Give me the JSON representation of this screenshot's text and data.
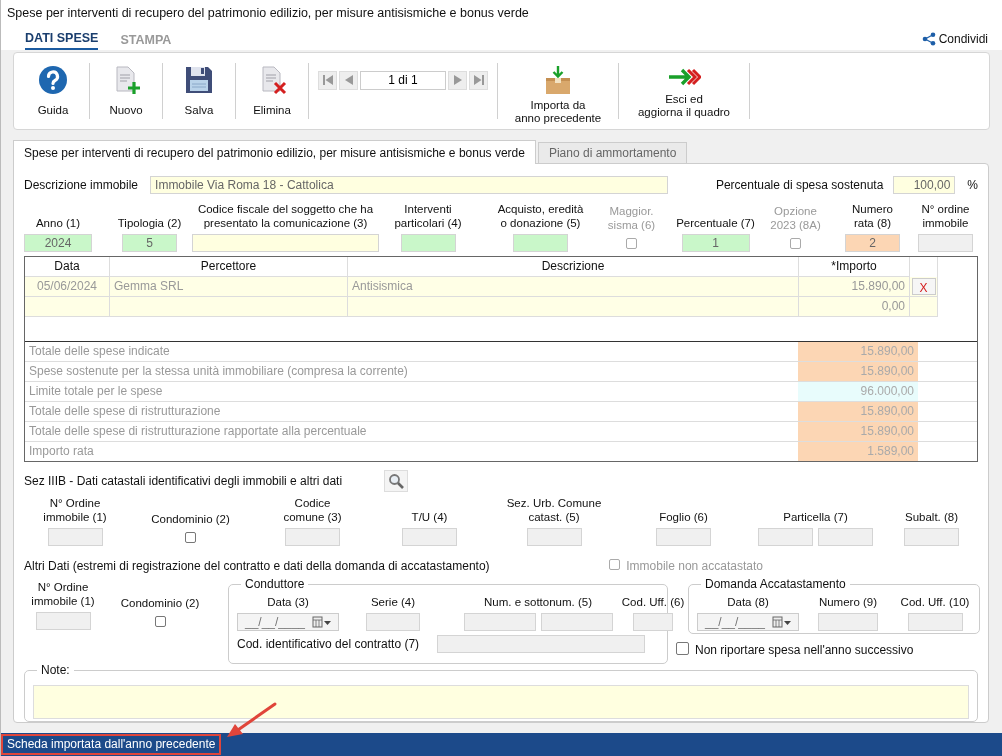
{
  "window": {
    "title": "Spese per interventi di recupero del patrimonio edilizio, per misure antisismiche e bonus verde"
  },
  "ribbon_tabs": [
    {
      "label": "DATI SPESE",
      "selected": true
    },
    {
      "label": "STAMPA",
      "selected": false
    }
  ],
  "share": {
    "label": "Condividi"
  },
  "toolbar": {
    "buttons": [
      {
        "kind": "help",
        "label": "Guida"
      },
      {
        "kind": "new",
        "label": "Nuovo"
      },
      {
        "kind": "save",
        "label": "Salva"
      },
      {
        "kind": "delete",
        "label": "Elimina"
      }
    ],
    "pager": {
      "value": "1 di 1"
    },
    "actions": [
      {
        "kind": "import",
        "label": "Importa da\nanno precedente"
      },
      {
        "kind": "exit",
        "label": "Esci ed\naggiorna il quadro"
      }
    ]
  },
  "form_tabs": [
    {
      "label": "Spese per interventi di recupero del patrimonio edilizio, per misure antisismiche e bonus verde",
      "selected": true
    },
    {
      "label": "Piano di ammortamento",
      "selected": false
    }
  ],
  "descrizione": {
    "label": "Descrizione immobile",
    "value": "Immobile Via Roma 18 - Cattolica"
  },
  "percentuale_spesa": {
    "label": "Percentuale di spesa sostenuta",
    "value": "100,00",
    "unit": "%"
  },
  "fields": [
    {
      "kind": "input",
      "label": "Anno (1)",
      "value": "2024",
      "color": "#c9f7c9",
      "disabled": false
    },
    {
      "kind": "input",
      "label": "Tipologia (2)",
      "value": "5",
      "color": "#c9f7c9",
      "disabled": false
    },
    {
      "kind": "input",
      "label": "Codice fiscale del soggetto che ha\npresentato la comunicazione (3)",
      "color": "#ffffe0",
      "disabled": false
    },
    {
      "kind": "input",
      "label": "Interventi\nparticolari (4)",
      "color": "#c9f7c9",
      "disabled": false
    },
    {
      "kind": "input",
      "label": "Acquisto, eredità\no donazione (5)",
      "color": "#c9f7c9",
      "disabled": false
    },
    {
      "kind": "checkbox",
      "label": "Maggior.\nsisma (6)",
      "checked": false,
      "disabled": true
    },
    {
      "kind": "input",
      "label": "Percentuale (7)",
      "value": "1",
      "color": "#c9f7c9",
      "disabled": false
    },
    {
      "kind": "checkbox",
      "label": "Opzione\n2023 (8A)",
      "checked": false,
      "disabled": true
    },
    {
      "kind": "input",
      "label": "Numero\nrata (8)",
      "value": "2",
      "color": "#fcd6b4",
      "disabled": false
    },
    {
      "kind": "input",
      "label": "N° ordine\nimmobile",
      "color": "#f0f0f0",
      "disabled": false
    }
  ],
  "expenses": {
    "columns": [
      "Data",
      "Percettore",
      "Descrizione",
      "*Importo"
    ],
    "rows": [
      {
        "data": "05/06/2024",
        "percettore": "Gemma SRL",
        "descrizione": "Antisismica",
        "importo": "15.890,00",
        "delete": "X"
      },
      {
        "importo": "0,00"
      }
    ],
    "totals": [
      {
        "label": "Totale delle spese indicate",
        "value": "15.890,00",
        "color": "#fcd6b4"
      },
      {
        "label": "Spese sostenute per la stessa unità immobiliare (compresa la corrente)",
        "value": "15.890,00",
        "color": "#fcd6b4"
      },
      {
        "label": "Limite totale per le spese",
        "value": "96.000,00",
        "color": "#e8fcfc"
      },
      {
        "label": "Totale delle spese di ristrutturazione",
        "value": "15.890,00",
        "color": "#fcd6b4"
      },
      {
        "label": "Totale delle spese di ristrutturazione rapportate alla percentuale",
        "value": "15.890,00",
        "color": "#fcd6b4"
      },
      {
        "label": "Importo rata",
        "value": "1.589,00",
        "color": "#fcd6b4"
      }
    ]
  },
  "catasto": {
    "title": "Sez IIIB - Dati catastali identificativi degli immobili e altri dati",
    "fields": [
      {
        "kind": "input",
        "label": "N° Ordine\nimmobile (1)",
        "disabled": false
      },
      {
        "kind": "checkbox",
        "label": "Condominio (2)",
        "checked": false,
        "disabled": false
      },
      {
        "kind": "input",
        "label": "Codice\ncomune (3)",
        "disabled": false
      },
      {
        "kind": "input",
        "label": "T/U (4)",
        "disabled": false
      },
      {
        "kind": "input",
        "label": "Sez. Urb. Comune\ncatast. (5)",
        "disabled": false
      },
      {
        "kind": "input",
        "label": "Foglio (6)",
        "disabled": false
      },
      {
        "kind": "double_input",
        "label": "Particella (7)",
        "disabled": false
      },
      {
        "kind": "input",
        "label": "Subalt. (8)",
        "disabled": false
      }
    ]
  },
  "altri_dati": {
    "title": "Altri Dati (estremi di registrazione del contratto e dati della domanda di accatastamento)",
    "non_accatastato": {
      "label": "Immobile non accatastato",
      "checked": false,
      "disabled": true
    },
    "fields": [
      {
        "kind": "input",
        "label": "N° Ordine\nimmobile (1)",
        "disabled": false
      },
      {
        "kind": "checkbox",
        "label": "Condominio (2)",
        "checked": false,
        "disabled": false
      }
    ],
    "conduttore": {
      "legend": "Conduttore",
      "fields": [
        {
          "kind": "date",
          "label": "Data (3)",
          "placeholder": "__/__/____",
          "disabled": false
        },
        {
          "kind": "input",
          "label": "Serie (4)",
          "disabled": false
        },
        {
          "kind": "double_input",
          "label": "Num. e sottonum. (5)",
          "disabled": false
        },
        {
          "kind": "input",
          "label": "Cod. Uff. (6)",
          "disabled": false
        }
      ],
      "contratto_label": "Cod. identificativo del contratto (7)"
    },
    "domanda": {
      "legend": "Domanda Accatastamento",
      "fields": [
        {
          "kind": "date",
          "label": "Data (8)",
          "placeholder": "__/__/____",
          "disabled": false
        },
        {
          "kind": "input",
          "label": "Numero (9)",
          "disabled": false
        },
        {
          "kind": "input",
          "label": "Cod. Uff. (10)",
          "disabled": false
        }
      ]
    },
    "non_riportare": {
      "label": "Non riportare spesa nell'anno successivo",
      "checked": false
    }
  },
  "note": {
    "legend": "Note:"
  },
  "status_bar": {
    "text": "Scheda importata dall'anno precedente",
    "highlighted": true
  }
}
